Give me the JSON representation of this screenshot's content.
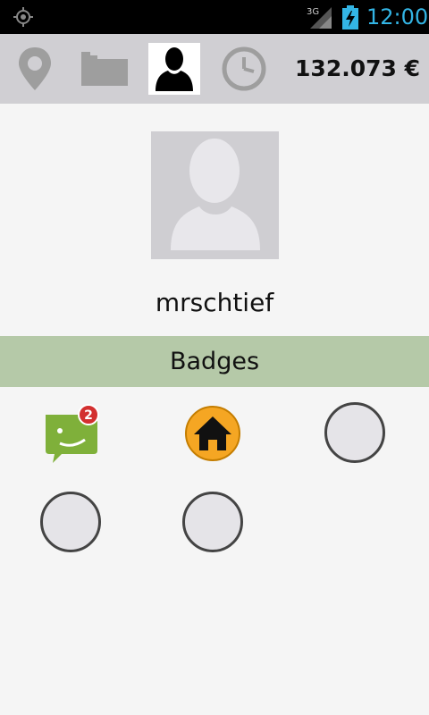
{
  "status_bar": {
    "network": "3G",
    "time": "12:00",
    "icons": [
      "gps-icon",
      "signal-icon",
      "battery-charging-icon"
    ],
    "time_color": "#33b5e5"
  },
  "toolbar": {
    "tabs": [
      {
        "icon": "location-pin-icon",
        "active": false
      },
      {
        "icon": "folder-icon",
        "active": false
      },
      {
        "icon": "profile-icon",
        "active": true
      },
      {
        "icon": "clock-icon",
        "active": false
      }
    ],
    "balance": "132.073 €"
  },
  "profile": {
    "username": "mrschtief",
    "avatar_icon": "default-avatar-icon"
  },
  "badges": {
    "title": "Badges",
    "header_color": "#b5c9a8",
    "items": [
      {
        "icon": "chat-badge-icon",
        "count": "2",
        "earned": true
      },
      {
        "icon": "home-badge-icon",
        "earned": true
      },
      {
        "icon": "empty-badge-slot",
        "earned": false
      },
      {
        "icon": "empty-badge-slot",
        "earned": false
      },
      {
        "icon": "empty-badge-slot",
        "earned": false
      }
    ]
  }
}
